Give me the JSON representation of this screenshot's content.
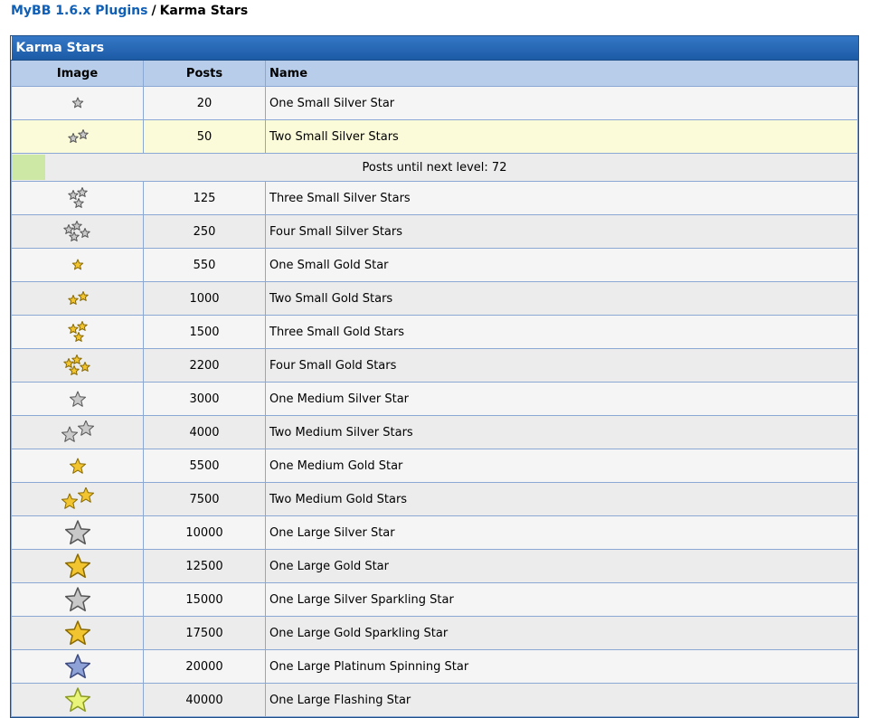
{
  "breadcrumb": {
    "parent": "MyBB 1.6.x Plugins",
    "separator": "/",
    "current": "Karma Stars"
  },
  "table": {
    "title": "Karma Stars",
    "columns": {
      "image": "Image",
      "posts": "Posts",
      "name": "Name"
    }
  },
  "progress": {
    "label": "Posts until next level: 72",
    "fraction": 0.04
  },
  "colors": {
    "silver": "#c9c9c9",
    "gold": "#f2c530",
    "platinum": "#8ea2d8",
    "flash": "#e9f57a",
    "header": "#1c5aa5",
    "highlight": "#fcfbd9"
  },
  "rows": [
    {
      "posts": "20",
      "name": "One Small Silver Star",
      "icon": "one-small-silver-star-icon"
    },
    {
      "posts": "50",
      "name": "Two Small Silver Stars",
      "icon": "two-small-silver-stars-icon"
    },
    {
      "posts": "125",
      "name": "Three Small Silver Stars",
      "icon": "three-small-silver-stars-icon"
    },
    {
      "posts": "250",
      "name": "Four Small Silver Stars",
      "icon": "four-small-silver-stars-icon"
    },
    {
      "posts": "550",
      "name": "One Small Gold Star",
      "icon": "one-small-gold-star-icon"
    },
    {
      "posts": "1000",
      "name": "Two Small Gold Stars",
      "icon": "two-small-gold-stars-icon"
    },
    {
      "posts": "1500",
      "name": "Three Small Gold Stars",
      "icon": "three-small-gold-stars-icon"
    },
    {
      "posts": "2200",
      "name": "Four Small Gold Stars",
      "icon": "four-small-gold-stars-icon"
    },
    {
      "posts": "3000",
      "name": "One Medium Silver Star",
      "icon": "one-medium-silver-star-icon"
    },
    {
      "posts": "4000",
      "name": "Two Medium Silver Stars",
      "icon": "two-medium-silver-stars-icon"
    },
    {
      "posts": "5500",
      "name": "One Medium Gold Star",
      "icon": "one-medium-gold-star-icon"
    },
    {
      "posts": "7500",
      "name": "Two Medium Gold Stars",
      "icon": "two-medium-gold-stars-icon"
    },
    {
      "posts": "10000",
      "name": "One Large Silver Star",
      "icon": "one-large-silver-star-icon"
    },
    {
      "posts": "12500",
      "name": "One Large Gold Star",
      "icon": "one-large-gold-star-icon"
    },
    {
      "posts": "15000",
      "name": "One Large Silver Sparkling Star",
      "icon": "one-large-silver-sparkling-star-icon"
    },
    {
      "posts": "17500",
      "name": "One Large Gold Sparkling Star",
      "icon": "one-large-gold-sparkling-star-icon"
    },
    {
      "posts": "20000",
      "name": "One Large Platinum Spinning Star",
      "icon": "one-large-platinum-spinning-star-icon"
    },
    {
      "posts": "40000",
      "name": "One Large Flashing Star",
      "icon": "one-large-flashing-star-icon"
    }
  ]
}
